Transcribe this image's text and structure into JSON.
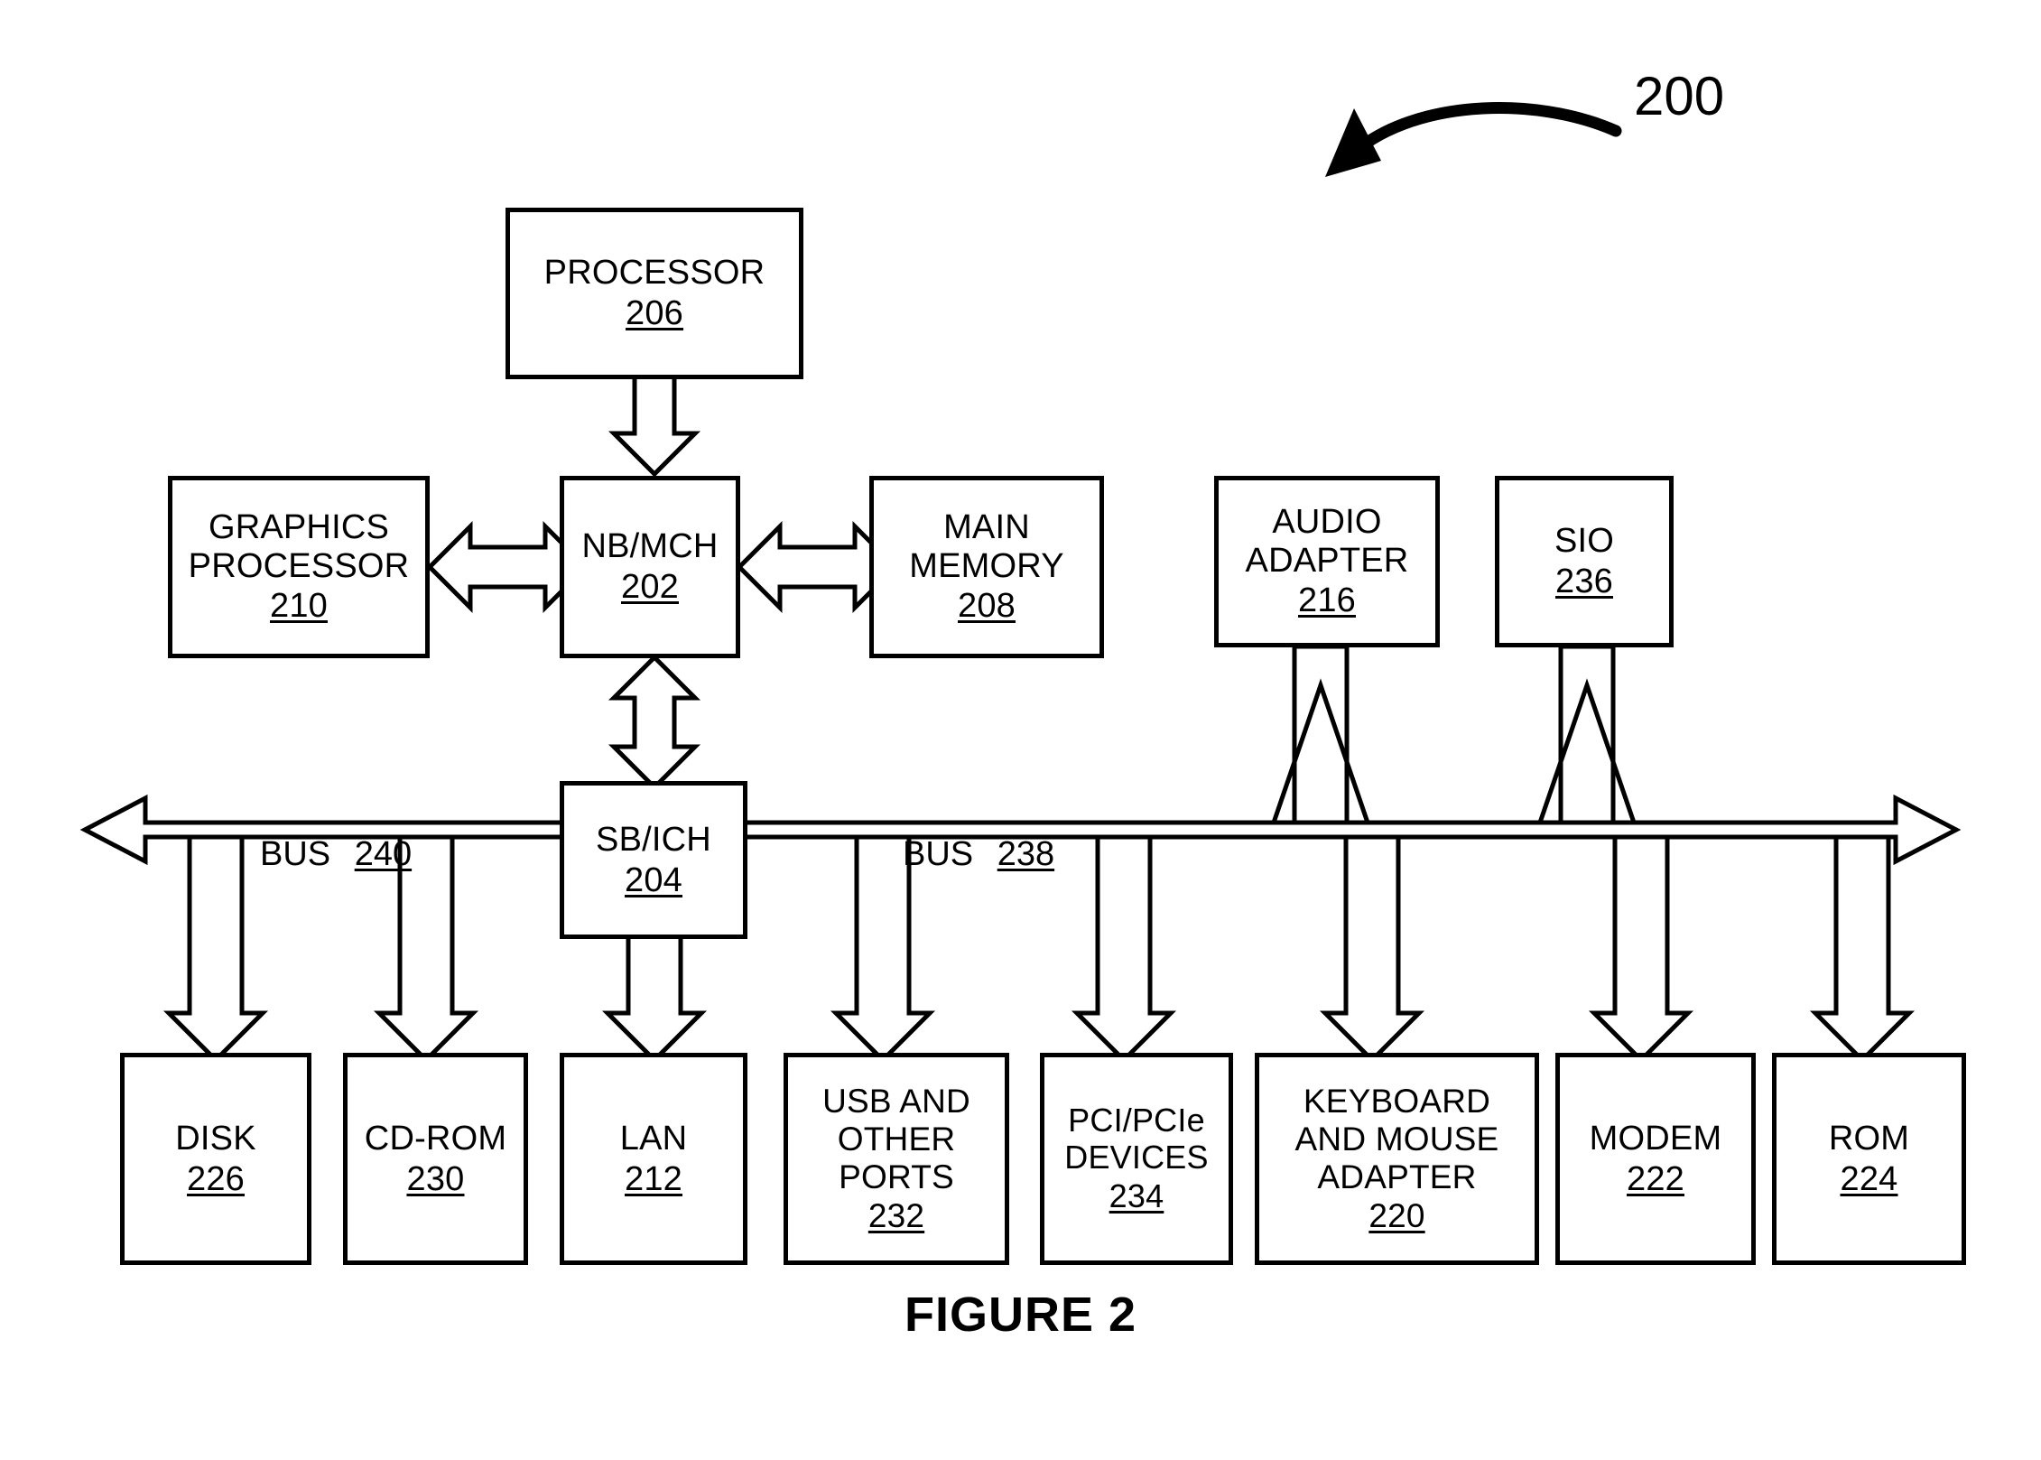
{
  "figure": {
    "caption": "FIGURE 2",
    "reference_numeral": "200"
  },
  "blocks": {
    "processor": {
      "label": "PROCESSOR",
      "number": "206"
    },
    "graphics": {
      "label": "GRAPHICS\nPROCESSOR",
      "number": "210"
    },
    "nbmch": {
      "label": "NB/MCH",
      "number": "202"
    },
    "main_memory": {
      "label": "MAIN\nMEMORY",
      "number": "208"
    },
    "audio_adapter": {
      "label": "AUDIO\nADAPTER",
      "number": "216"
    },
    "sio": {
      "label": "SIO",
      "number": "236"
    },
    "sbich": {
      "label": "SB/ICH",
      "number": "204"
    },
    "disk": {
      "label": "DISK",
      "number": "226"
    },
    "cdrom": {
      "label": "CD-ROM",
      "number": "230"
    },
    "lan": {
      "label": "LAN",
      "number": "212"
    },
    "usb_ports": {
      "label": "USB AND\nOTHER\nPORTS",
      "number": "232"
    },
    "pci_devices": {
      "label": "PCI/PCIe\nDEVICES",
      "number": "234"
    },
    "keyboard_mouse": {
      "label": "KEYBOARD\nAND MOUSE\nADAPTER",
      "number": "220"
    },
    "modem": {
      "label": "MODEM",
      "number": "222"
    },
    "rom": {
      "label": "ROM",
      "number": "224"
    }
  },
  "buses": {
    "left": {
      "label": "BUS",
      "number": "240"
    },
    "right": {
      "label": "BUS",
      "number": "238"
    }
  },
  "colors": {
    "stroke": "#000000",
    "fill": "#ffffff",
    "text": "#000000"
  }
}
